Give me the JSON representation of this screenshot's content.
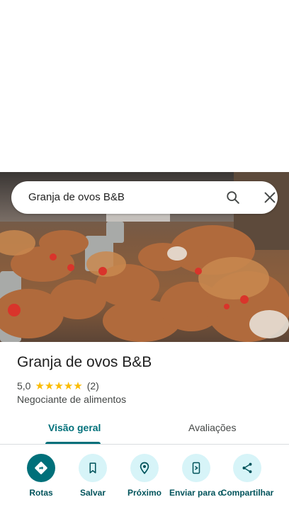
{
  "search": {
    "query": "Granja de ovos B&B",
    "search_icon": "search-icon",
    "close_icon": "close-icon"
  },
  "place": {
    "name": "Granja de ovos B&B",
    "rating": "5,0",
    "stars": 5,
    "review_count": "(2)",
    "category": "Negociante de alimentos"
  },
  "tabs": [
    {
      "label": "Visão geral",
      "selected": true
    },
    {
      "label": "Avaliações",
      "selected": false
    }
  ],
  "actions": [
    {
      "label": "Rotas",
      "icon": "directions-icon"
    },
    {
      "label": "Salvar",
      "icon": "bookmark-icon"
    },
    {
      "label": "Próximo",
      "icon": "nearby-icon"
    },
    {
      "label": "Enviar para o",
      "icon": "send-to-phone-icon"
    },
    {
      "label": "Compartilhar",
      "icon": "share-icon"
    }
  ],
  "colors": {
    "accent": "#00707a",
    "action_bg": "#d7f4f8",
    "star": "#fbbc04"
  }
}
